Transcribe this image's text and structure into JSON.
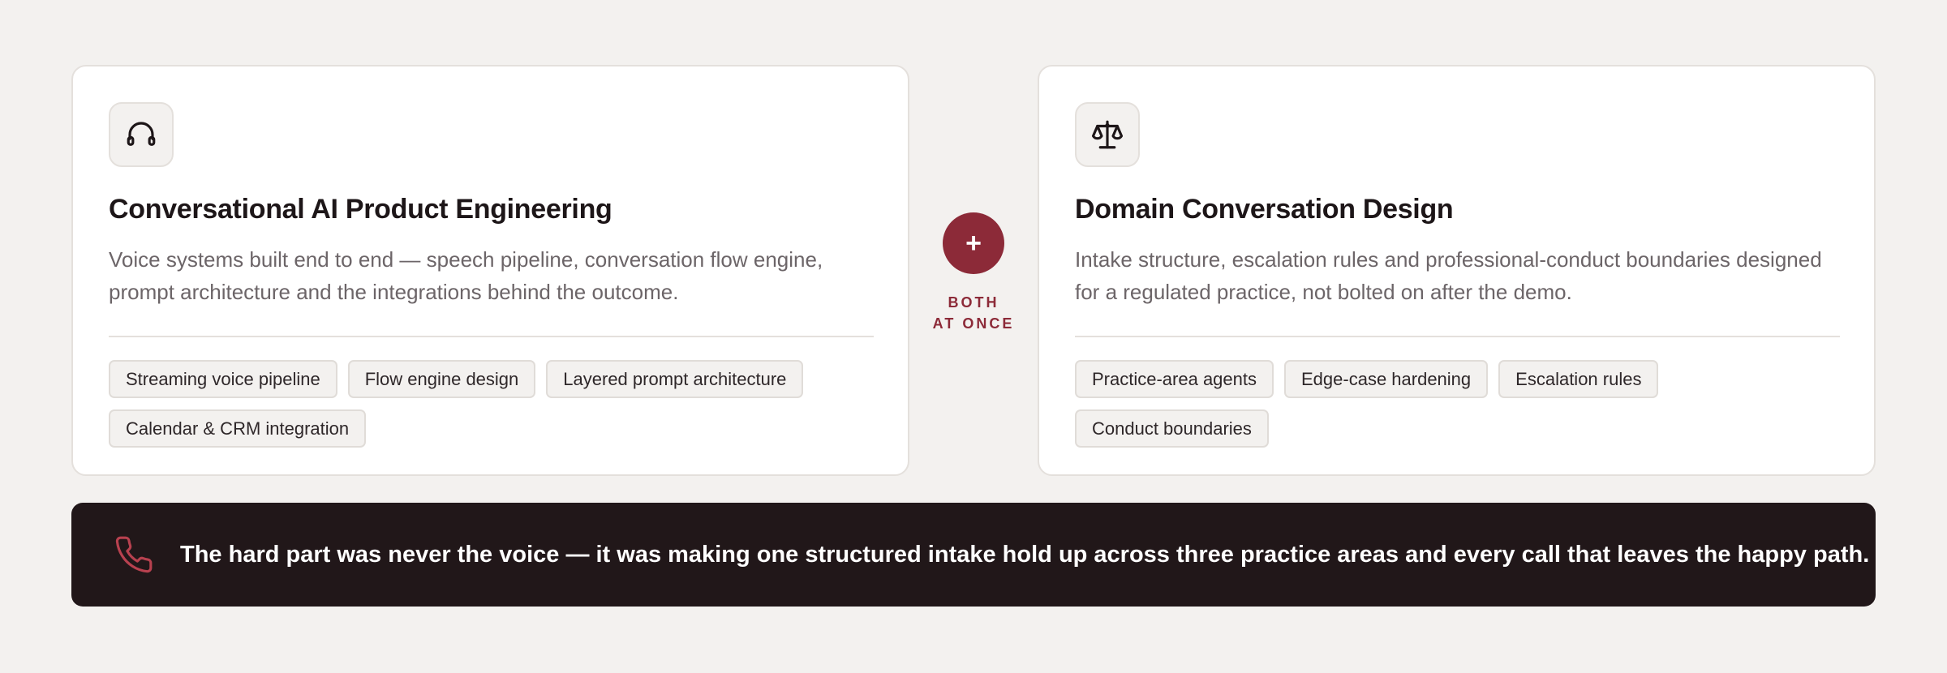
{
  "left_card": {
    "icon": "headphones-icon",
    "title": "Conversational AI Product Engineering",
    "description": "Voice systems built end to end — speech pipeline, conversation flow engine, prompt architecture and the integrations behind the outcome.",
    "tags": [
      "Streaming voice pipeline",
      "Flow engine design",
      "Layered prompt architecture",
      "Calendar & CRM integration"
    ]
  },
  "connector": {
    "symbol": "+",
    "label_line1": "BOTH",
    "label_line2": "AT ONCE"
  },
  "right_card": {
    "icon": "scales-icon",
    "title": "Domain Conversation Design",
    "description": "Intake structure, escalation rules and professional-conduct boundaries designed for a regulated practice, not bolted on after the demo.",
    "tags": [
      "Practice-area agents",
      "Edge-case hardening",
      "Escalation rules",
      "Conduct boundaries"
    ]
  },
  "banner": {
    "icon": "phone-icon",
    "text": "The hard part was never the voice — it was making one structured intake hold up across three practice areas and every call that leaves the happy path."
  },
  "colors": {
    "accent": "#8c2a38",
    "banner_bg": "#211719",
    "page_bg": "#f3f1ef"
  }
}
